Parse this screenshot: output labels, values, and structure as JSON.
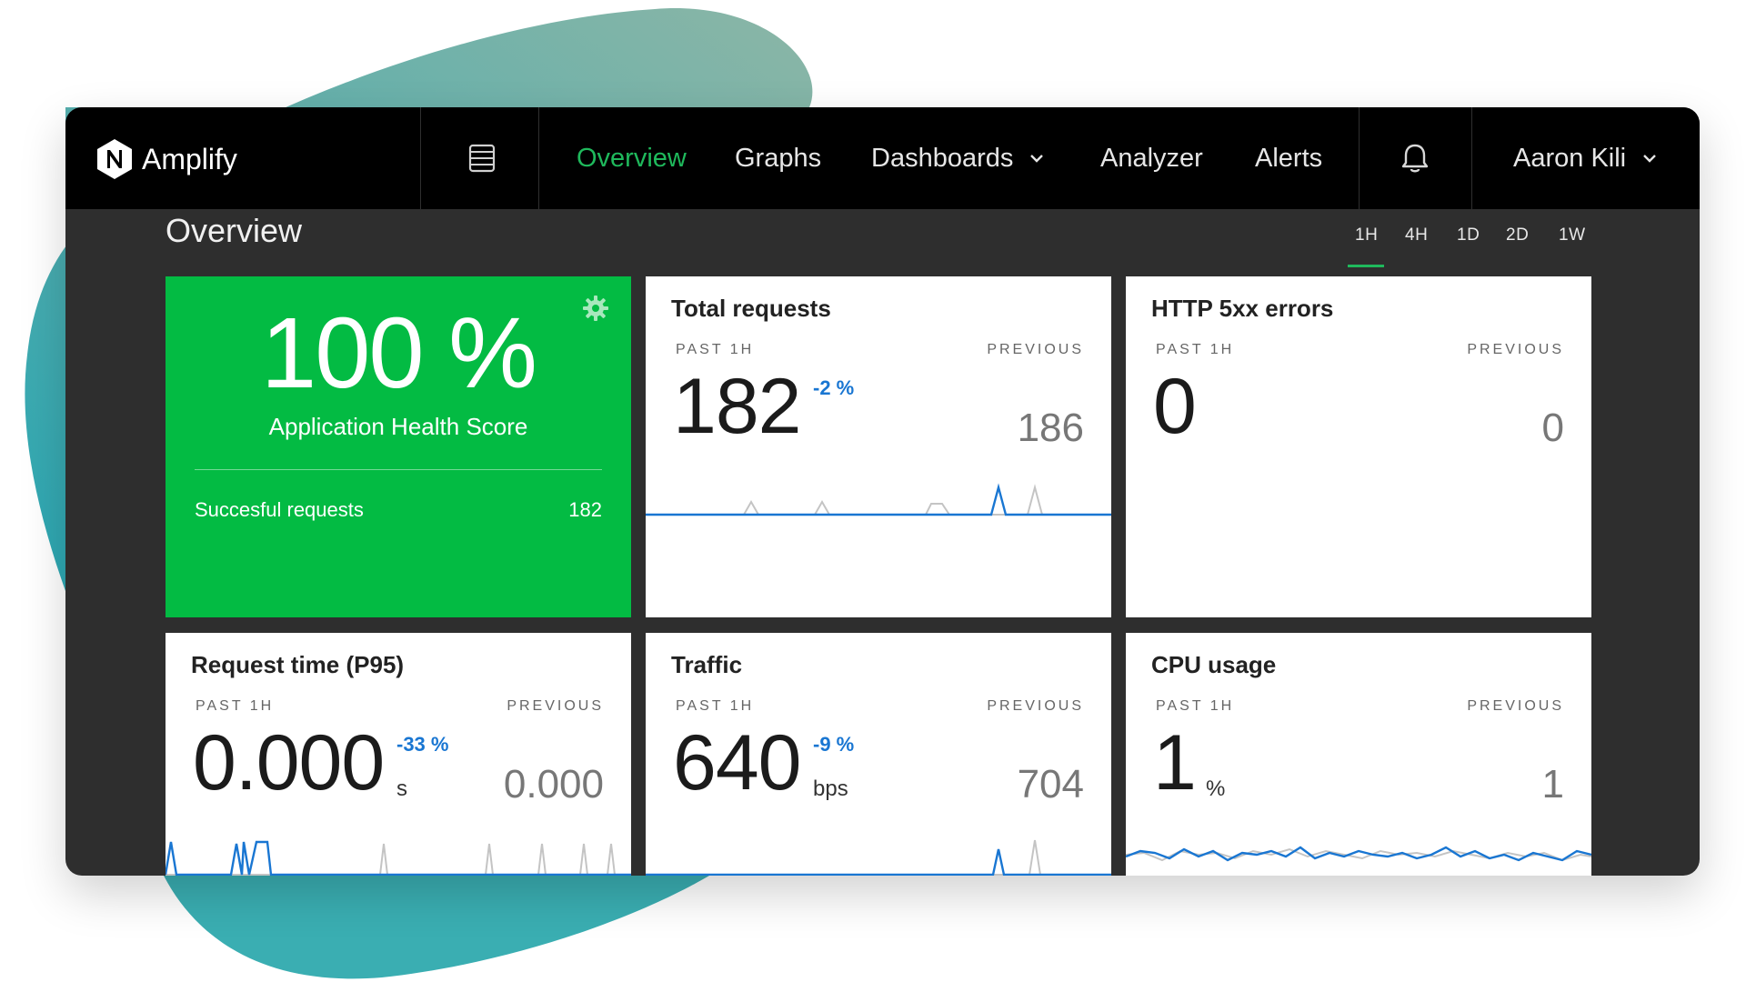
{
  "app": {
    "name": "Amplify"
  },
  "nav": {
    "overview": "Overview",
    "graphs": "Graphs",
    "dashboards": "Dashboards",
    "analyzer": "Analyzer",
    "alerts": "Alerts",
    "user": "Aaron Kili"
  },
  "page": {
    "title": "Overview"
  },
  "time_ranges": [
    "1H",
    "4H",
    "1D",
    "2D",
    "1W"
  ],
  "selected_range": "1H",
  "colors": {
    "accent": "#1fb95c",
    "health_green": "#03bb43",
    "current_series": "#1976d2",
    "previous_series": "#c4c4c4",
    "topbar": "#000000",
    "background": "#2e2e2e"
  },
  "health": {
    "value": "100 %",
    "label": "Application Health Score",
    "requests_label": "Succesful requests",
    "requests_value": "182"
  },
  "cards": [
    {
      "title": "Total requests",
      "past_label": "PAST 1H",
      "prev_label": "PREVIOUS",
      "value": "182",
      "unit": "",
      "change": "-2 %",
      "previous": "186"
    },
    {
      "title": "HTTP 5xx errors",
      "past_label": "PAST 1H",
      "prev_label": "PREVIOUS",
      "value": "0",
      "unit": "",
      "change": "",
      "previous": "0"
    },
    {
      "title": "Request time (P95)",
      "past_label": "PAST 1H",
      "prev_label": "PREVIOUS",
      "value": "0.000",
      "unit": "s",
      "change": "-33 %",
      "previous": "0.000"
    },
    {
      "title": "Traffic",
      "past_label": "PAST 1H",
      "prev_label": "PREVIOUS",
      "value": "640",
      "unit": "bps",
      "change": "-9 %",
      "previous": "704"
    },
    {
      "title": "CPU usage",
      "past_label": "PAST 1H",
      "prev_label": "PREVIOUS",
      "value": "1",
      "unit": "%",
      "change": "",
      "previous": "1"
    }
  ],
  "icons": {
    "logo": "nginx-n-logo",
    "server": "server-stack-icon",
    "bell": "bell-icon",
    "gear": "gear-icon",
    "chevron": "chevron-down-icon"
  }
}
